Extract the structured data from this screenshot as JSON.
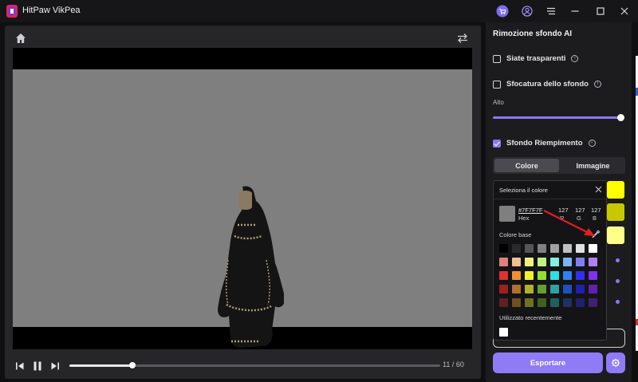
{
  "app": {
    "title": "HitPaw VikPea"
  },
  "titlebar": {
    "icons": [
      "cart-icon",
      "account-icon",
      "menu-icon",
      "minimize-icon",
      "maximize-icon",
      "close-icon"
    ]
  },
  "viewer": {
    "icons": [
      "home-icon",
      "swap-icon"
    ],
    "canvas_color": "#7f7f7f"
  },
  "playback": {
    "progress": 0.17,
    "frame_text": "11 / 60"
  },
  "panel": {
    "title": "Rimozione sfondo AI",
    "options": [
      {
        "label": "Siate trasparenti",
        "checked": false
      },
      {
        "label": "Sfocatura dello sfondo",
        "checked": false
      },
      {
        "label": "Sfondo Riempimento",
        "checked": true
      }
    ],
    "blur_level_label": "Alto",
    "blur_level": 1.0,
    "tabs": [
      {
        "label": "Colore",
        "active": true
      },
      {
        "label": "Immagine",
        "active": false
      }
    ],
    "side_swatches": [
      "#ffff00",
      "#c8c800",
      "#ffff88"
    ],
    "export_label": "Esportare",
    "accent": "#8f7bf5"
  },
  "picker": {
    "title": "Seleziona il colore",
    "hex_value": "#7F7F7F",
    "hex_label": "Hex",
    "r_value": "127",
    "r_label": "R",
    "g_value": "127",
    "g_label": "G",
    "b_value": "127",
    "b_label": "B",
    "base_label": "Colore base",
    "recent_label": "Utilizzato recentemente",
    "palette": [
      "#000000",
      "#2a2a2a",
      "#555555",
      "#808080",
      "#a0a0a0",
      "#c0c0c0",
      "#e0e0e0",
      "#ffffff",
      "#e08080",
      "#f0c090",
      "#f0f080",
      "#c0f080",
      "#80f0e0",
      "#80b0f0",
      "#8080f0",
      "#b080f0",
      "#e03030",
      "#f09030",
      "#f0f030",
      "#90e030",
      "#30e0e0",
      "#3080f0",
      "#3030f0",
      "#8030f0",
      "#a02020",
      "#b07030",
      "#b0b030",
      "#60a030",
      "#30a0a0",
      "#2050c0",
      "#2020b0",
      "#6020b0",
      "#602020",
      "#705020",
      "#707020",
      "#406020",
      "#206060",
      "#203060",
      "#202070",
      "#402070"
    ],
    "recent": [
      "#ffffff"
    ]
  }
}
